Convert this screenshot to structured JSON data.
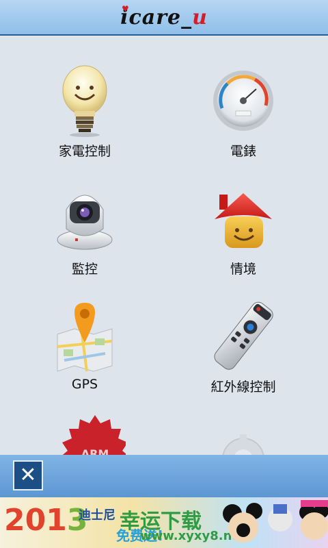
{
  "app": {
    "logo_prefix": "care",
    "logo_suffix": "u"
  },
  "grid": {
    "items": [
      {
        "label": "家電控制",
        "icon": "lightbulb-icon"
      },
      {
        "label": "電錶",
        "icon": "gauge-icon"
      },
      {
        "label": "監控",
        "icon": "camera-icon"
      },
      {
        "label": "情境",
        "icon": "house-icon"
      },
      {
        "label": "GPS",
        "icon": "map-pin-icon"
      },
      {
        "label": "紅外線控制",
        "icon": "remote-icon"
      },
      {
        "label": "ARM",
        "icon": "arm-badge-icon"
      },
      {
        "label": "",
        "icon": "gear-icon"
      }
    ]
  },
  "bottom_bar": {
    "close_label": "✕"
  },
  "ad": {
    "year_a": "201",
    "year_b": "3",
    "line1": "迪士尼",
    "line2": "幸运下载",
    "line3": "免费送!",
    "watermark": "www.xyxy8.net"
  },
  "colors": {
    "header": "#8fbfe9",
    "background": "#dde4ec",
    "bottom_bar": "#5d97d1",
    "close_button": "#1c4f86"
  }
}
